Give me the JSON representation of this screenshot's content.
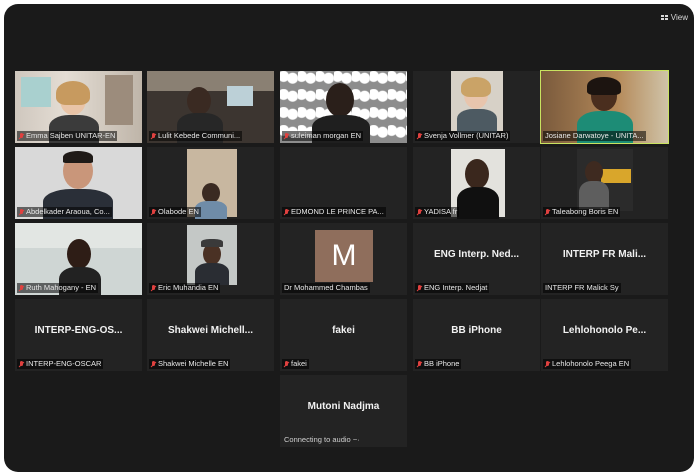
{
  "toolbar": {
    "view_label": "View"
  },
  "tiles": [
    {
      "name": "Emma Sajben UNITAR-EN",
      "muted": true
    },
    {
      "name": "Lulit Kebede Communi...",
      "muted": true
    },
    {
      "name": "suleiman morgan EN",
      "muted": true
    },
    {
      "name": "Svenja Vollmer (UNITAR)",
      "muted": true
    },
    {
      "name": "Josiane Darwatoye - UNITA...",
      "muted": false,
      "active": true
    },
    {
      "name": "Abdelkader Araoua, Co...",
      "muted": true
    },
    {
      "name": "Olabode EN",
      "muted": true
    },
    {
      "name": "EDMOND LE PRINCE PA...",
      "muted": true
    },
    {
      "name": "YADISA fr",
      "muted": true
    },
    {
      "name": "Taleabong Boris EN",
      "muted": true
    },
    {
      "name": "Ruth Mahogany - EN",
      "muted": true
    },
    {
      "name": "Eric Muhandia EN",
      "muted": true
    },
    {
      "name": "Dr Mohammed Chambas",
      "muted": false,
      "avatar_letter": "M"
    },
    {
      "name": "ENG Interp. Nedjat",
      "muted": true,
      "display_name": "ENG Interp. Ned..."
    },
    {
      "name": "INTERP FR Malick Sy",
      "muted": false,
      "display_name": "INTERP FR Mali..."
    },
    {
      "name": "INTERP-ENG-OSCAR",
      "muted": true,
      "display_name": "INTERP-ENG-OS..."
    },
    {
      "name": "Shakwei Michelle EN",
      "muted": true,
      "display_name": "Shakwei Michell..."
    },
    {
      "name": "fakei",
      "muted": true,
      "display_name": "fakei"
    },
    {
      "name": "BB iPhone",
      "muted": true,
      "display_name": "BB iPhone"
    },
    {
      "name": "Lehlohonolo Peega EN",
      "muted": true,
      "display_name": "Lehlohonolo Pe..."
    },
    {
      "name": "",
      "muted": false,
      "display_name": "Mutoni Nadjma",
      "status": "Connecting to audio"
    }
  ]
}
